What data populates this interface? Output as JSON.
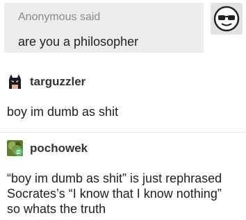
{
  "ask": {
    "asker": "Anonymous said",
    "question": "are you a philosopher",
    "avatar_icon": "sunglasses-face-icon"
  },
  "posts": [
    {
      "username": "targuzzler",
      "avatar_icon": "batman-mask-icon",
      "text_lines": [
        "boy im dumb as shit"
      ]
    },
    {
      "username": "pochowek",
      "avatar_icon": "reblog-icon",
      "text_lines": [
        "“boy im dumb as shit” is just rephrased",
        "Socrates’s “I know that I know nothing”",
        "so whats the truth"
      ]
    }
  ],
  "colors": {
    "ask_background": "#ececec",
    "reblog_badge": "#56b870"
  }
}
